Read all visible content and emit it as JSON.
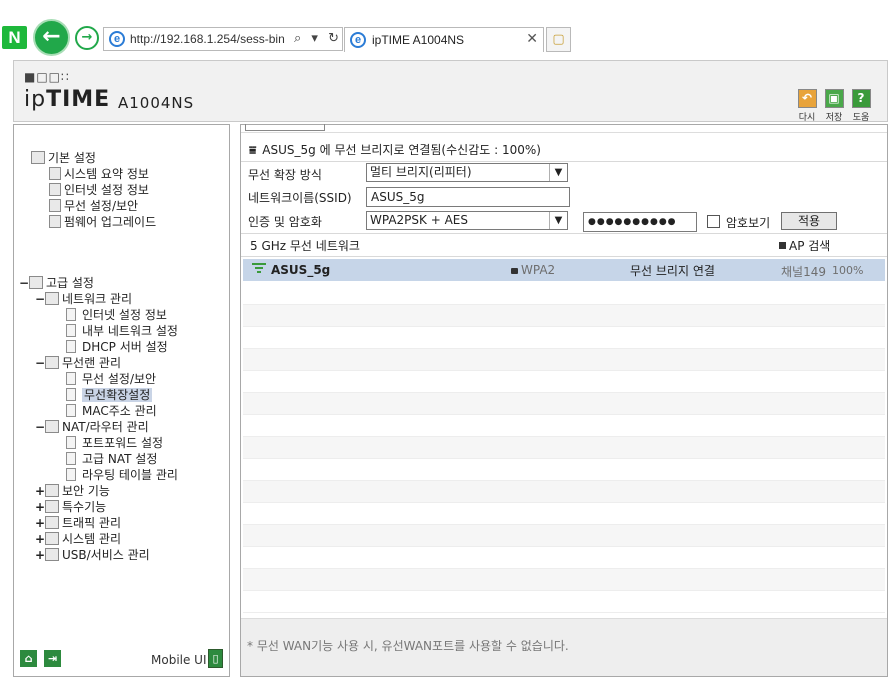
{
  "browser": {
    "url": "http://192.168.1.254/sess-bin",
    "address_controls": "⌕ ▾ ↻",
    "tab_title": "ipTIME A1004NS"
  },
  "header": {
    "logo_light": "ip",
    "logo_bold": "TIME",
    "model": "A1004NS",
    "buttons": [
      {
        "label": "다시",
        "icon": "undo-icon",
        "color": "#e8a33a"
      },
      {
        "label": "저장",
        "icon": "save-icon",
        "color": "#4aa84a"
      },
      {
        "label": "도움",
        "icon": "help-icon",
        "color": "#3a9a3a"
      }
    ]
  },
  "sidebar": {
    "basic": {
      "label": "기본 설정",
      "items": [
        "시스템 요약 정보",
        "인터넷 설정 정보",
        "무선 설정/보안",
        "펌웨어 업그레이드"
      ]
    },
    "advanced": {
      "label": "고급 설정",
      "network": {
        "label": "네트워크 관리",
        "items": [
          "인터넷 설정 정보",
          "내부 네트워크 설정",
          "DHCP 서버 설정"
        ]
      },
      "wireless": {
        "label": "무선랜 관리",
        "items": [
          "무선 설정/보안",
          "무선확장설정",
          "MAC주소 관리"
        ],
        "selected_index": 1
      },
      "nat": {
        "label": "NAT/라우터 관리",
        "items": [
          "포트포워드 설정",
          "고급 NAT 설정",
          "라우팅 테이블 관리"
        ]
      },
      "others": [
        "보안 기능",
        "특수기능",
        "트래픽 관리",
        "시스템 관리",
        "USB/서비스 관리"
      ]
    },
    "mobile_ui": "Mobile UI"
  },
  "main": {
    "status": "ASUS_5g 에 무선 브리지로 연결됨(수신감도 : 100%)",
    "mode_label": "무선 확장 방식",
    "mode_value": "멀티 브리지(리피터)",
    "ssid_label": "네트워크이름(SSID)",
    "ssid_value": "ASUS_5g",
    "auth_label": "인증 및 암호화",
    "auth_value": "WPA2PSK + AES",
    "password_mask": "●●●●●●●●●●",
    "show_password_label": "암호보기",
    "apply_label": "적용",
    "network_header": "5 GHz 무선 네트워크",
    "ap_search_label": "AP 검색",
    "networks": [
      {
        "ssid": "ASUS_5g",
        "security": "WPA2",
        "status": "무선 브리지 연결",
        "channel": "채널149",
        "signal": "100%"
      }
    ],
    "footer_note": "* 무선 WAN기능 사용 시, 유선WAN포트를 사용할 수 없습니다."
  }
}
